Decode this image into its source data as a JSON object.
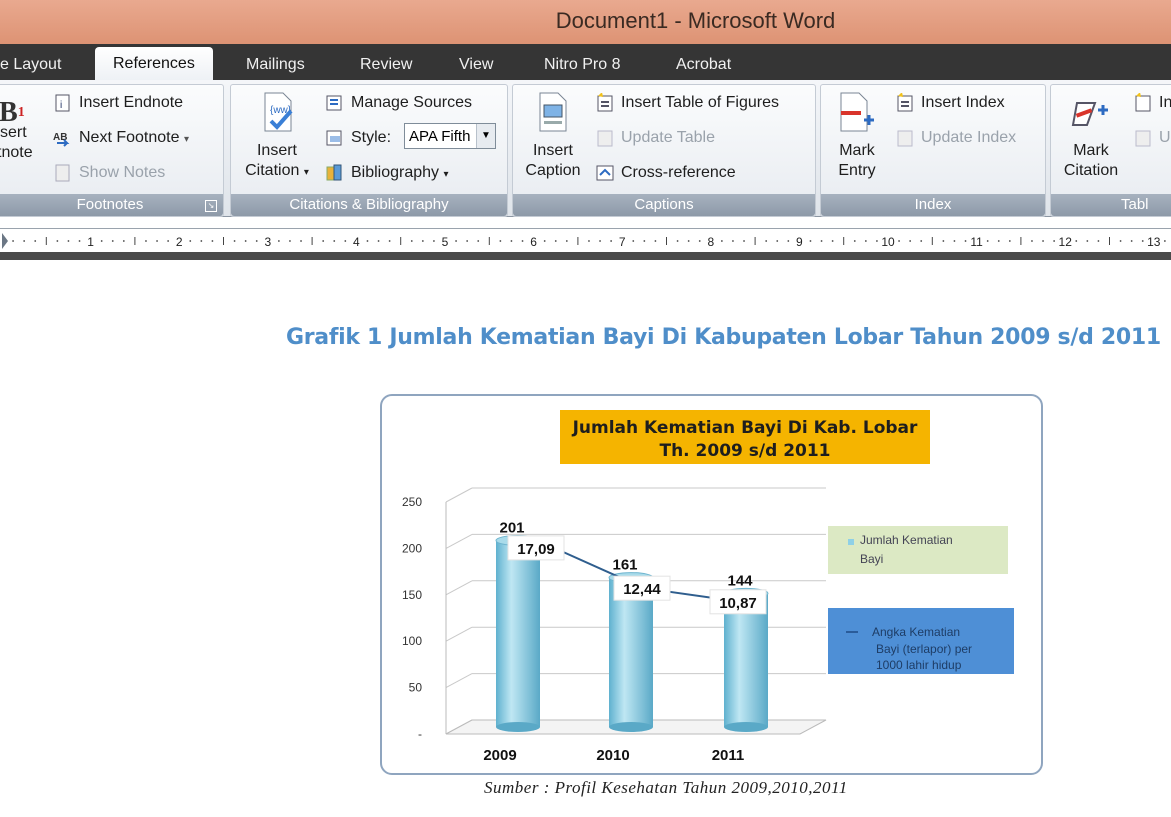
{
  "window": {
    "title": "Document1 - Microsoft Word"
  },
  "tabs": [
    {
      "label": "e Layout"
    },
    {
      "label": "References"
    },
    {
      "label": "Mailings"
    },
    {
      "label": "Review"
    },
    {
      "label": "View"
    },
    {
      "label": "Nitro Pro 8"
    },
    {
      "label": "Acrobat"
    }
  ],
  "ribbon": {
    "footnotes": {
      "label": "Footnotes",
      "insert_footnote_1": "sert",
      "insert_footnote_2": "tnote",
      "insert_endnote": "Insert Endnote",
      "next_footnote": "Next Footnote",
      "show_notes": "Show Notes"
    },
    "citations": {
      "label": "Citations & Bibliography",
      "insert_citation_1": "Insert",
      "insert_citation_2": "Citation",
      "manage_sources": "Manage Sources",
      "style_label": "Style:",
      "style_value": "APA Fifth",
      "bibliography": "Bibliography"
    },
    "captions": {
      "label": "Captions",
      "insert_caption_1": "Insert",
      "insert_caption_2": "Caption",
      "insert_table_of_figures": "Insert Table of Figures",
      "update_table": "Update Table",
      "cross_reference": "Cross-reference"
    },
    "index": {
      "label": "Index",
      "mark_entry_1": "Mark",
      "mark_entry_2": "Entry",
      "insert_index": "Insert Index",
      "update_index": "Update Index"
    },
    "toa": {
      "label": "Tabl",
      "mark_citation_1": "Mark",
      "mark_citation_2": "Citation",
      "insert_toa": "In",
      "update_toa": "U"
    }
  },
  "ruler": {
    "numbers": [
      "1",
      "2",
      "3",
      "4",
      "5",
      "6",
      "7",
      "8",
      "9",
      "10",
      "11",
      "12",
      "13"
    ]
  },
  "document": {
    "heading": "Grafik 1 Jumlah Kematian Bayi Di Kabupaten Lobar Tahun 2009 s/d 2011",
    "source": "Sumber : Profil Kesehatan Tahun 2009,2010,2011"
  },
  "chart_data": {
    "type": "bar",
    "title_line1": "Jumlah Kematian Bayi Di Kab. Lobar",
    "title_line2": "Th. 2009 s/d 2011",
    "categories": [
      "2009",
      "2010",
      "2011"
    ],
    "ylim": [
      0,
      250
    ],
    "yticks": [
      "0",
      "50",
      "100",
      "150",
      "200",
      "250"
    ],
    "series": [
      {
        "name": "Jumlah Kematian Bayi",
        "type": "bar",
        "values": [
          201,
          161,
          144
        ],
        "labels": [
          "201",
          "161",
          "144"
        ]
      },
      {
        "name": "Angka Kematian Bayi (terlapor) per 1000 lahir hidup",
        "type": "line",
        "values": [
          17.09,
          12.44,
          10.87
        ],
        "labels": [
          "17,09",
          "12,44",
          "10,87"
        ]
      }
    ],
    "colors": {
      "bar": "#8fd0e6",
      "title_bg": "#f5b400",
      "legend1_bg": "#dce9c4",
      "legend2_bg": "#4e8fd6"
    }
  }
}
